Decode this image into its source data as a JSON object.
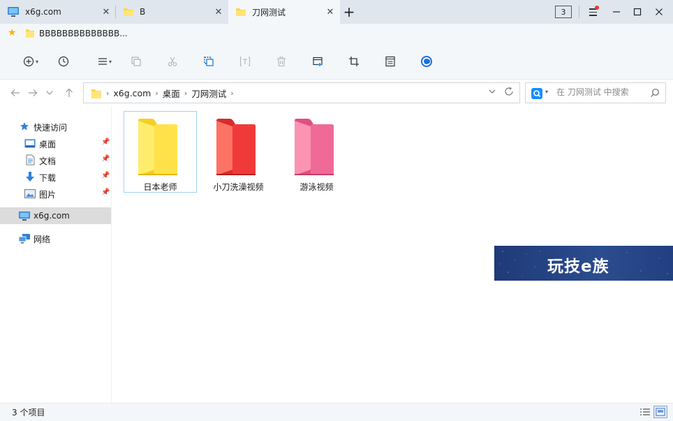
{
  "tabs": [
    {
      "label": "x6g.com",
      "icon": "computer-icon",
      "active": false
    },
    {
      "label": "B",
      "icon": "folder-icon",
      "active": false
    },
    {
      "label": "刀网测试",
      "icon": "folder-icon",
      "active": true
    }
  ],
  "titlebar": {
    "tab_count": "3",
    "new_tab_symbol": "+",
    "menu_has_notification": true
  },
  "favorites": {
    "items": [
      {
        "label": "BBBBBBBBBBBBBB..."
      }
    ]
  },
  "toolbar": {
    "buttons": [
      {
        "name": "new-button",
        "icon": "plus-circle-icon",
        "enabled": true
      },
      {
        "name": "history-button",
        "icon": "clock-icon",
        "enabled": true
      },
      {
        "name": "view-menu-button",
        "icon": "list-icon",
        "enabled": true
      },
      {
        "name": "copy-button",
        "icon": "copy-icon",
        "enabled": false
      },
      {
        "name": "cut-button",
        "icon": "scissors-icon",
        "enabled": false
      },
      {
        "name": "paste-button",
        "icon": "paste-icon",
        "enabled": true
      },
      {
        "name": "rename-button",
        "icon": "rename-icon",
        "enabled": false
      },
      {
        "name": "delete-button",
        "icon": "trash-icon",
        "enabled": false
      },
      {
        "name": "new-window-button",
        "icon": "window-icon",
        "enabled": true
      },
      {
        "name": "crop-button",
        "icon": "crop-icon",
        "enabled": true
      },
      {
        "name": "notes-button",
        "icon": "notes-icon",
        "enabled": true
      },
      {
        "name": "extension-button",
        "icon": "app-logo-icon",
        "enabled": true
      }
    ]
  },
  "address": {
    "breadcrumbs": [
      "x6g.com",
      "桌面",
      "刀网测试"
    ]
  },
  "search": {
    "placeholder": "在 刀网测试 中搜索"
  },
  "sidebar": {
    "quick_access_label": "快速访问",
    "quick_items": [
      {
        "label": "桌面",
        "icon": "desktop-icon",
        "pinned": true
      },
      {
        "label": "文档",
        "icon": "document-icon",
        "pinned": true
      },
      {
        "label": "下载",
        "icon": "download-icon",
        "pinned": true
      },
      {
        "label": "图片",
        "icon": "pictures-icon",
        "pinned": true
      }
    ],
    "this_pc_label": "x6g.com",
    "network_label": "网络"
  },
  "files": [
    {
      "name": "日本老师",
      "color": "yellow",
      "selected": true
    },
    {
      "name": "小刀洗澡视频",
      "color": "red",
      "selected": false
    },
    {
      "name": "游泳视频",
      "color": "pink",
      "selected": false
    }
  ],
  "colors": {
    "folder_yellow": "#ffe24a",
    "folder_red": "#f03a3a",
    "folder_pink": "#f06a98",
    "selection_border": "#9fd3f7",
    "sidebar_selected": "#dcdcdc",
    "accent": "#1a8cff"
  },
  "watermark": {
    "text": "玩技e族"
  },
  "status": {
    "item_count": "3 个项目"
  }
}
